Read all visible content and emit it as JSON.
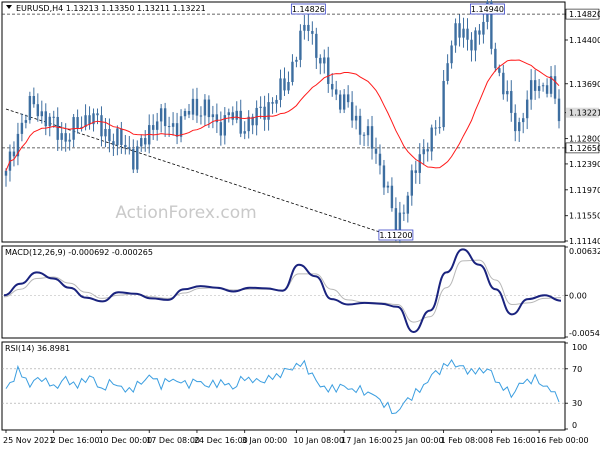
{
  "chart_data": [
    {
      "type": "candlestick",
      "title": "EURUSD,H4  1.13213 1.13350 1.13211 1.13221",
      "watermark": "ActionForex.com",
      "ylim": [
        1.1114,
        1.15
      ],
      "y_ticks": [
        1.1482,
        1.144,
        1.1369,
        1.13221,
        1.128,
        1.1265,
        1.1239,
        1.1197,
        1.1155,
        1.1114
      ],
      "y_tick_labels": [
        "1.14820",
        "1.14400",
        "1.13690",
        "1.13221",
        "1.12800",
        "1.12650",
        "1.12390",
        "1.11970",
        "1.11550",
        "1.11140"
      ],
      "levels": [
        1.1482,
        1.1265
      ],
      "current_price": 1.13221,
      "current_price_label": "1.13221",
      "annotations": [
        {
          "text": "1.14826",
          "x_index": 76,
          "y": 1.14826
        },
        {
          "text": "1.14940",
          "x_index": 121,
          "y": 1.1494
        },
        {
          "text": "1.11200",
          "x_index": 98,
          "y": 1.112
        }
      ],
      "trendline": {
        "from": {
          "x_index": 0,
          "y": 1.1328
        },
        "to": {
          "x_index": 98,
          "y": 1.112
        }
      },
      "anchors": [
        {
          "i": 0,
          "v": 1.122
        },
        {
          "i": 2,
          "v": 1.127
        },
        {
          "i": 4,
          "v": 1.1305
        },
        {
          "i": 7,
          "v": 1.134
        },
        {
          "i": 9,
          "v": 1.1318
        },
        {
          "i": 12,
          "v": 1.13
        },
        {
          "i": 15,
          "v": 1.128
        },
        {
          "i": 18,
          "v": 1.13
        },
        {
          "i": 21,
          "v": 1.132
        },
        {
          "i": 24,
          "v": 1.1295
        },
        {
          "i": 27,
          "v": 1.128
        },
        {
          "i": 30,
          "v": 1.1268
        },
        {
          "i": 32,
          "v": 1.125
        },
        {
          "i": 35,
          "v": 1.1278
        },
        {
          "i": 38,
          "v": 1.132
        },
        {
          "i": 41,
          "v": 1.1295
        },
        {
          "i": 44,
          "v": 1.131
        },
        {
          "i": 47,
          "v": 1.133
        },
        {
          "i": 50,
          "v": 1.133
        },
        {
          "i": 53,
          "v": 1.13
        },
        {
          "i": 56,
          "v": 1.132
        },
        {
          "i": 59,
          "v": 1.13
        },
        {
          "i": 62,
          "v": 1.131
        },
        {
          "i": 65,
          "v": 1.133
        },
        {
          "i": 68,
          "v": 1.1345
        },
        {
          "i": 71,
          "v": 1.138
        },
        {
          "i": 74,
          "v": 1.144
        },
        {
          "i": 76,
          "v": 1.147
        },
        {
          "i": 78,
          "v": 1.142
        },
        {
          "i": 80,
          "v": 1.139
        },
        {
          "i": 83,
          "v": 1.135
        },
        {
          "i": 86,
          "v": 1.133
        },
        {
          "i": 89,
          "v": 1.13
        },
        {
          "i": 92,
          "v": 1.127
        },
        {
          "i": 95,
          "v": 1.122
        },
        {
          "i": 97,
          "v": 1.116
        },
        {
          "i": 98,
          "v": 1.1125
        },
        {
          "i": 100,
          "v": 1.1175
        },
        {
          "i": 103,
          "v": 1.123
        },
        {
          "i": 106,
          "v": 1.128
        },
        {
          "i": 109,
          "v": 1.13
        },
        {
          "i": 111,
          "v": 1.142
        },
        {
          "i": 113,
          "v": 1.1455
        },
        {
          "i": 116,
          "v": 1.144
        },
        {
          "i": 119,
          "v": 1.145
        },
        {
          "i": 121,
          "v": 1.1485
        },
        {
          "i": 123,
          "v": 1.14
        },
        {
          "i": 125,
          "v": 1.136
        },
        {
          "i": 127,
          "v": 1.132
        },
        {
          "i": 129,
          "v": 1.13
        },
        {
          "i": 131,
          "v": 1.134
        },
        {
          "i": 133,
          "v": 1.1372
        },
        {
          "i": 135,
          "v": 1.1365
        },
        {
          "i": 137,
          "v": 1.1362
        },
        {
          "i": 139,
          "v": 1.1322
        }
      ],
      "ma_period": 20,
      "colors": {
        "candle": "#3d6ea0",
        "ma": "#ff1a1a",
        "level": "#333333",
        "annotation_border": "#3a46c8"
      }
    },
    {
      "type": "line",
      "title": "MACD(12,26,9) -0.000692 -0.000265",
      "ylim": [
        -0.005455,
        0.00632
      ],
      "y_ticks": [
        0.00632,
        0.0,
        -0.005455
      ],
      "y_tick_labels": [
        "0.00632",
        "0.00",
        "-0.005455"
      ],
      "series": [
        {
          "values": [
            0,
            0.0015,
            0.003,
            0.0022,
            0.001,
            -0.0003,
            -0.0008,
            0.0004,
            0.0002,
            -0.0004,
            -0.0006,
            0.0008,
            0.0012,
            0.001,
            0.0005,
            0.001,
            0.0009,
            0.0006,
            0.004,
            0.0025,
            -0.0005,
            -0.0012,
            -0.001,
            -0.0011,
            -0.0015,
            -0.0048,
            -0.002,
            0.003,
            0.006,
            0.004,
            0.0008,
            -0.0025,
            -0.0005,
            0.0,
            -0.0007
          ]
        },
        {
          "values": [
            -0.0002,
            0.0008,
            0.0022,
            0.0024,
            0.0016,
            0.0004,
            -0.0004,
            0.0,
            0.0002,
            -0.0002,
            -0.0004,
            0.0003,
            0.0009,
            0.001,
            0.0007,
            0.0008,
            0.0008,
            0.0007,
            0.0028,
            0.0028,
            0.0008,
            -0.0006,
            -0.0009,
            -0.001,
            -0.0012,
            -0.0035,
            -0.0028,
            0.001,
            0.0045,
            0.0046,
            0.002,
            -0.0012,
            -0.001,
            -0.0004,
            -0.0003
          ]
        }
      ],
      "colors": {
        "macd": "#1a237e",
        "signal": "#b8b8b8"
      }
    },
    {
      "type": "line",
      "title": "RSI(14) 36.8981",
      "ylim": [
        0,
        100
      ],
      "y_ticks": [
        100,
        70,
        30,
        0
      ],
      "y_tick_labels": [
        "100",
        "70",
        "30",
        "0"
      ],
      "levels": [
        70,
        30
      ],
      "anchors": [
        {
          "i": 0,
          "v": 45
        },
        {
          "i": 3,
          "v": 68
        },
        {
          "i": 6,
          "v": 52
        },
        {
          "i": 9,
          "v": 60
        },
        {
          "i": 12,
          "v": 48
        },
        {
          "i": 15,
          "v": 58
        },
        {
          "i": 18,
          "v": 50
        },
        {
          "i": 21,
          "v": 62
        },
        {
          "i": 24,
          "v": 46
        },
        {
          "i": 27,
          "v": 55
        },
        {
          "i": 30,
          "v": 44
        },
        {
          "i": 33,
          "v": 50
        },
        {
          "i": 36,
          "v": 62
        },
        {
          "i": 39,
          "v": 52
        },
        {
          "i": 42,
          "v": 58
        },
        {
          "i": 45,
          "v": 52
        },
        {
          "i": 48,
          "v": 56
        },
        {
          "i": 51,
          "v": 50
        },
        {
          "i": 54,
          "v": 55
        },
        {
          "i": 57,
          "v": 48
        },
        {
          "i": 60,
          "v": 60
        },
        {
          "i": 63,
          "v": 55
        },
        {
          "i": 66,
          "v": 58
        },
        {
          "i": 69,
          "v": 64
        },
        {
          "i": 72,
          "v": 72
        },
        {
          "i": 75,
          "v": 76
        },
        {
          "i": 78,
          "v": 55
        },
        {
          "i": 81,
          "v": 45
        },
        {
          "i": 84,
          "v": 50
        },
        {
          "i": 87,
          "v": 46
        },
        {
          "i": 90,
          "v": 44
        },
        {
          "i": 93,
          "v": 38
        },
        {
          "i": 96,
          "v": 25
        },
        {
          "i": 98,
          "v": 18
        },
        {
          "i": 101,
          "v": 35
        },
        {
          "i": 104,
          "v": 45
        },
        {
          "i": 107,
          "v": 62
        },
        {
          "i": 110,
          "v": 72
        },
        {
          "i": 112,
          "v": 78
        },
        {
          "i": 115,
          "v": 70
        },
        {
          "i": 118,
          "v": 66
        },
        {
          "i": 121,
          "v": 70
        },
        {
          "i": 124,
          "v": 52
        },
        {
          "i": 127,
          "v": 40
        },
        {
          "i": 130,
          "v": 55
        },
        {
          "i": 133,
          "v": 58
        },
        {
          "i": 136,
          "v": 48
        },
        {
          "i": 139,
          "v": 37
        }
      ],
      "colors": {
        "rsi": "#3b9ee0",
        "level": "#a0a0a0"
      }
    }
  ],
  "x_axis": {
    "labels": [
      "25 Nov 2021",
      "2 Dec 16:00",
      "10 Dec 00:00",
      "17 Dec 08:00",
      "24 Dec 16:00",
      "3 Jan 00:00",
      "10 Jan 08:00",
      "17 Jan 16:00",
      "25 Jan 00:00",
      "1 Feb 08:00",
      "8 Feb 16:00",
      "16 Feb 00:00"
    ],
    "bar_index": [
      0,
      12,
      24,
      36,
      48,
      60,
      73,
      85,
      98,
      110,
      122,
      134
    ]
  }
}
